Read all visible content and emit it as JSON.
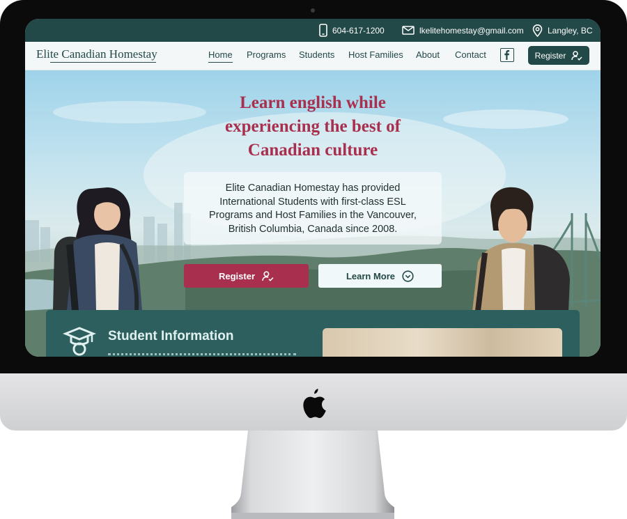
{
  "device": {
    "brand_icon": "apple-icon"
  },
  "topbar": {
    "phone": "604-617-1200",
    "email": "lkelitehomestay@gmail.com",
    "location": "Langley, BC",
    "icons": [
      "phone-icon",
      "mail-icon",
      "location-pin-icon"
    ]
  },
  "nav": {
    "logo": "Elite Canadian Homestay",
    "links": [
      "Home",
      "Programs",
      "Students",
      "Host Families",
      "About",
      "Contact"
    ],
    "active": "Home",
    "social_icon": "facebook-icon",
    "register_label": "Register"
  },
  "hero": {
    "headline_lines": [
      "Learn english while",
      "experiencing the best of",
      "Canadian culture"
    ],
    "description_lines": [
      "Elite Canadian Homestay has provided",
      "International Students with first-class ESL",
      "Programs and Host Families in the Vancouver,",
      "British Columbia, Canada since 2008."
    ],
    "register_label": "Register",
    "learn_more_label": "Learn More"
  },
  "student_section": {
    "title": "Student Information",
    "icon": "graduate-icon"
  },
  "colors": {
    "primary_dark": "#234848",
    "accent": "#a8304e",
    "panel": "#2e5f5f"
  }
}
